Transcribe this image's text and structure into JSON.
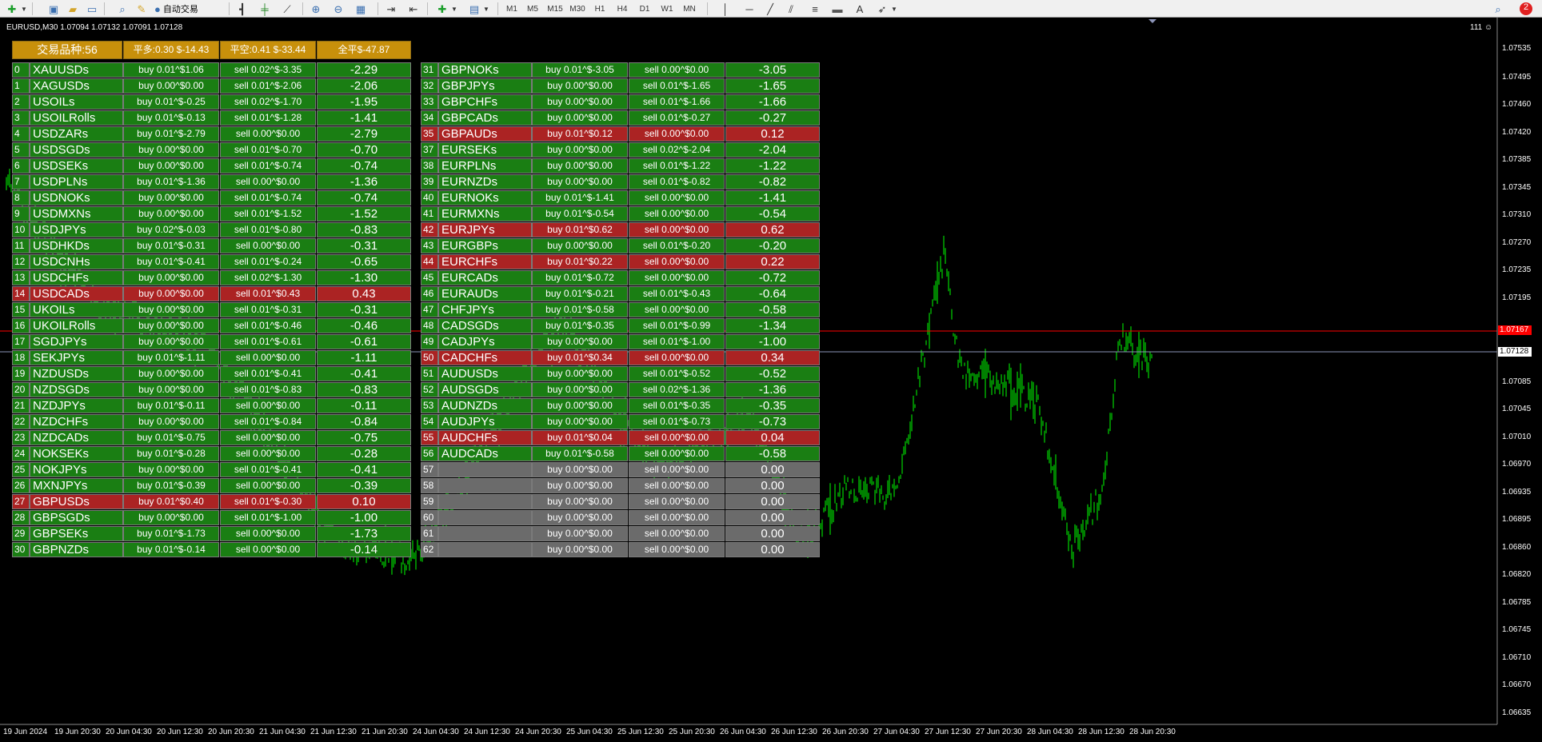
{
  "toolbar": {
    "auto_trading_label": "自动交易",
    "timeframes": [
      "M1",
      "M5",
      "M15",
      "M30",
      "H1",
      "H4",
      "D1",
      "W1",
      "MN"
    ],
    "notification_count": "2"
  },
  "chart": {
    "title": "EURUSD,M30  1.07094 1.07132 1.07091 1.07128",
    "counter": "111",
    "price_axis": [
      "1.07535",
      "1.07495",
      "1.07460",
      "1.07420",
      "1.07385",
      "1.07345",
      "1.07310",
      "1.07270",
      "1.07235",
      "1.07195",
      "1.07120",
      "1.07085",
      "1.07045",
      "1.07010",
      "1.06970",
      "1.06935",
      "1.06895",
      "1.06860",
      "1.06820",
      "1.06785",
      "1.06745",
      "1.06710",
      "1.06670",
      "1.06635"
    ],
    "ask_label": "1.07167",
    "bid_label": "1.07128",
    "time_axis": [
      "19 Jun 2024",
      "19 Jun 20:30",
      "20 Jun 04:30",
      "20 Jun 12:30",
      "20 Jun 20:30",
      "21 Jun 04:30",
      "21 Jun 12:30",
      "21 Jun 20:30",
      "24 Jun 04:30",
      "24 Jun 12:30",
      "24 Jun 20:30",
      "25 Jun 04:30",
      "25 Jun 12:30",
      "25 Jun 20:30",
      "26 Jun 04:30",
      "26 Jun 12:30",
      "26 Jun 20:30",
      "27 Jun 04:30",
      "27 Jun 12:30",
      "27 Jun 20:30",
      "28 Jun 04:30",
      "28 Jun 12:30",
      "28 Jun 20:30"
    ],
    "colors": {
      "bars": "#00ff00",
      "ask_line": "#ff0000",
      "bid_line": "#8c94b8",
      "background": "#000000"
    }
  },
  "panel": {
    "header": {
      "symbols": "交易品种:56",
      "close_buy": "平多:0.30 $-14.43",
      "close_sell": "平空:0.41 $-33.44",
      "close_all": "全平$-47.87"
    },
    "rows": [
      {
        "i": "0",
        "sym": "XAUUSDs",
        "buy": "buy 0.01^$1.06",
        "sell": "sell 0.02^$-3.35",
        "net": "-2.29",
        "st": "g"
      },
      {
        "i": "1",
        "sym": "XAGUSDs",
        "buy": "buy 0.00^$0.00",
        "sell": "sell 0.01^$-2.06",
        "net": "-2.06",
        "st": "g"
      },
      {
        "i": "2",
        "sym": "USOILs",
        "buy": "buy 0.01^$-0.25",
        "sell": "sell 0.02^$-1.70",
        "net": "-1.95",
        "st": "g"
      },
      {
        "i": "3",
        "sym": "USOILRolls",
        "buy": "buy 0.01^$-0.13",
        "sell": "sell 0.01^$-1.28",
        "net": "-1.41",
        "st": "g"
      },
      {
        "i": "4",
        "sym": "USDZARs",
        "buy": "buy 0.01^$-2.79",
        "sell": "sell 0.00^$0.00",
        "net": "-2.79",
        "st": "g"
      },
      {
        "i": "5",
        "sym": "USDSGDs",
        "buy": "buy 0.00^$0.00",
        "sell": "sell 0.01^$-0.70",
        "net": "-0.70",
        "st": "g"
      },
      {
        "i": "6",
        "sym": "USDSEKs",
        "buy": "buy 0.00^$0.00",
        "sell": "sell 0.01^$-0.74",
        "net": "-0.74",
        "st": "g"
      },
      {
        "i": "7",
        "sym": "USDPLNs",
        "buy": "buy 0.01^$-1.36",
        "sell": "sell 0.00^$0.00",
        "net": "-1.36",
        "st": "g"
      },
      {
        "i": "8",
        "sym": "USDNOKs",
        "buy": "buy 0.00^$0.00",
        "sell": "sell 0.01^$-0.74",
        "net": "-0.74",
        "st": "g"
      },
      {
        "i": "9",
        "sym": "USDMXNs",
        "buy": "buy 0.00^$0.00",
        "sell": "sell 0.01^$-1.52",
        "net": "-1.52",
        "st": "g"
      },
      {
        "i": "10",
        "sym": "USDJPYs",
        "buy": "buy 0.02^$-0.03",
        "sell": "sell 0.01^$-0.80",
        "net": "-0.83",
        "st": "g"
      },
      {
        "i": "11",
        "sym": "USDHKDs",
        "buy": "buy 0.01^$-0.31",
        "sell": "sell 0.00^$0.00",
        "net": "-0.31",
        "st": "g"
      },
      {
        "i": "12",
        "sym": "USDCNHs",
        "buy": "buy 0.01^$-0.41",
        "sell": "sell 0.01^$-0.24",
        "net": "-0.65",
        "st": "g"
      },
      {
        "i": "13",
        "sym": "USDCHFs",
        "buy": "buy 0.00^$0.00",
        "sell": "sell 0.02^$-1.30",
        "net": "-1.30",
        "st": "g"
      },
      {
        "i": "14",
        "sym": "USDCADs",
        "buy": "buy 0.00^$0.00",
        "sell": "sell 0.01^$0.43",
        "net": "0.43",
        "st": "r"
      },
      {
        "i": "15",
        "sym": "UKOILs",
        "buy": "buy 0.00^$0.00",
        "sell": "sell 0.01^$-0.31",
        "net": "-0.31",
        "st": "g"
      },
      {
        "i": "16",
        "sym": "UKOILRolls",
        "buy": "buy 0.00^$0.00",
        "sell": "sell 0.01^$-0.46",
        "net": "-0.46",
        "st": "g"
      },
      {
        "i": "17",
        "sym": "SGDJPYs",
        "buy": "buy 0.00^$0.00",
        "sell": "sell 0.01^$-0.61",
        "net": "-0.61",
        "st": "g"
      },
      {
        "i": "18",
        "sym": "SEKJPYs",
        "buy": "buy 0.01^$-1.11",
        "sell": "sell 0.00^$0.00",
        "net": "-1.11",
        "st": "g"
      },
      {
        "i": "19",
        "sym": "NZDUSDs",
        "buy": "buy 0.00^$0.00",
        "sell": "sell 0.01^$-0.41",
        "net": "-0.41",
        "st": "g"
      },
      {
        "i": "20",
        "sym": "NZDSGDs",
        "buy": "buy 0.00^$0.00",
        "sell": "sell 0.01^$-0.83",
        "net": "-0.83",
        "st": "g"
      },
      {
        "i": "21",
        "sym": "NZDJPYs",
        "buy": "buy 0.01^$-0.11",
        "sell": "sell 0.00^$0.00",
        "net": "-0.11",
        "st": "g"
      },
      {
        "i": "22",
        "sym": "NZDCHFs",
        "buy": "buy 0.00^$0.00",
        "sell": "sell 0.01^$-0.84",
        "net": "-0.84",
        "st": "g"
      },
      {
        "i": "23",
        "sym": "NZDCADs",
        "buy": "buy 0.01^$-0.75",
        "sell": "sell 0.00^$0.00",
        "net": "-0.75",
        "st": "g"
      },
      {
        "i": "24",
        "sym": "NOKSEKs",
        "buy": "buy 0.01^$-0.28",
        "sell": "sell 0.00^$0.00",
        "net": "-0.28",
        "st": "g"
      },
      {
        "i": "25",
        "sym": "NOKJPYs",
        "buy": "buy 0.00^$0.00",
        "sell": "sell 0.01^$-0.41",
        "net": "-0.41",
        "st": "g"
      },
      {
        "i": "26",
        "sym": "MXNJPYs",
        "buy": "buy 0.01^$-0.39",
        "sell": "sell 0.00^$0.00",
        "net": "-0.39",
        "st": "g"
      },
      {
        "i": "27",
        "sym": "GBPUSDs",
        "buy": "buy 0.01^$0.40",
        "sell": "sell 0.01^$-0.30",
        "net": "0.10",
        "st": "r"
      },
      {
        "i": "28",
        "sym": "GBPSGDs",
        "buy": "buy 0.00^$0.00",
        "sell": "sell 0.01^$-1.00",
        "net": "-1.00",
        "st": "g"
      },
      {
        "i": "29",
        "sym": "GBPSEKs",
        "buy": "buy 0.01^$-1.73",
        "sell": "sell 0.00^$0.00",
        "net": "-1.73",
        "st": "g"
      },
      {
        "i": "30",
        "sym": "GBPNZDs",
        "buy": "buy 0.01^$-0.14",
        "sell": "sell 0.00^$0.00",
        "net": "-0.14",
        "st": "g"
      },
      {
        "i": "31",
        "sym": "GBPNOKs",
        "buy": "buy 0.01^$-3.05",
        "sell": "sell 0.00^$0.00",
        "net": "-3.05",
        "st": "g"
      },
      {
        "i": "32",
        "sym": "GBPJPYs",
        "buy": "buy 0.00^$0.00",
        "sell": "sell 0.01^$-1.65",
        "net": "-1.65",
        "st": "g"
      },
      {
        "i": "33",
        "sym": "GBPCHFs",
        "buy": "buy 0.00^$0.00",
        "sell": "sell 0.01^$-1.66",
        "net": "-1.66",
        "st": "g"
      },
      {
        "i": "34",
        "sym": "GBPCADs",
        "buy": "buy 0.00^$0.00",
        "sell": "sell 0.01^$-0.27",
        "net": "-0.27",
        "st": "g"
      },
      {
        "i": "35",
        "sym": "GBPAUDs",
        "buy": "buy 0.01^$0.12",
        "sell": "sell 0.00^$0.00",
        "net": "0.12",
        "st": "r"
      },
      {
        "i": "37",
        "sym": "EURSEKs",
        "buy": "buy 0.00^$0.00",
        "sell": "sell 0.02^$-2.04",
        "net": "-2.04",
        "st": "g"
      },
      {
        "i": "38",
        "sym": "EURPLNs",
        "buy": "buy 0.00^$0.00",
        "sell": "sell 0.01^$-1.22",
        "net": "-1.22",
        "st": "g"
      },
      {
        "i": "39",
        "sym": "EURNZDs",
        "buy": "buy 0.00^$0.00",
        "sell": "sell 0.01^$-0.82",
        "net": "-0.82",
        "st": "g"
      },
      {
        "i": "40",
        "sym": "EURNOKs",
        "buy": "buy 0.01^$-1.41",
        "sell": "sell 0.00^$0.00",
        "net": "-1.41",
        "st": "g"
      },
      {
        "i": "41",
        "sym": "EURMXNs",
        "buy": "buy 0.01^$-0.54",
        "sell": "sell 0.00^$0.00",
        "net": "-0.54",
        "st": "g"
      },
      {
        "i": "42",
        "sym": "EURJPYs",
        "buy": "buy 0.01^$0.62",
        "sell": "sell 0.00^$0.00",
        "net": "0.62",
        "st": "r"
      },
      {
        "i": "43",
        "sym": "EURGBPs",
        "buy": "buy 0.00^$0.00",
        "sell": "sell 0.01^$-0.20",
        "net": "-0.20",
        "st": "g"
      },
      {
        "i": "44",
        "sym": "EURCHFs",
        "buy": "buy 0.01^$0.22",
        "sell": "sell 0.00^$0.00",
        "net": "0.22",
        "st": "r"
      },
      {
        "i": "45",
        "sym": "EURCADs",
        "buy": "buy 0.01^$-0.72",
        "sell": "sell 0.00^$0.00",
        "net": "-0.72",
        "st": "g"
      },
      {
        "i": "46",
        "sym": "EURAUDs",
        "buy": "buy 0.01^$-0.21",
        "sell": "sell 0.01^$-0.43",
        "net": "-0.64",
        "st": "g"
      },
      {
        "i": "47",
        "sym": "CHFJPYs",
        "buy": "buy 0.01^$-0.58",
        "sell": "sell 0.00^$0.00",
        "net": "-0.58",
        "st": "g"
      },
      {
        "i": "48",
        "sym": "CADSGDs",
        "buy": "buy 0.01^$-0.35",
        "sell": "sell 0.01^$-0.99",
        "net": "-1.34",
        "st": "g"
      },
      {
        "i": "49",
        "sym": "CADJPYs",
        "buy": "buy 0.00^$0.00",
        "sell": "sell 0.01^$-1.00",
        "net": "-1.00",
        "st": "g"
      },
      {
        "i": "50",
        "sym": "CADCHFs",
        "buy": "buy 0.01^$0.34",
        "sell": "sell 0.00^$0.00",
        "net": "0.34",
        "st": "r"
      },
      {
        "i": "51",
        "sym": "AUDUSDs",
        "buy": "buy 0.00^$0.00",
        "sell": "sell 0.01^$-0.52",
        "net": "-0.52",
        "st": "g"
      },
      {
        "i": "52",
        "sym": "AUDSGDs",
        "buy": "buy 0.00^$0.00",
        "sell": "sell 0.02^$-1.36",
        "net": "-1.36",
        "st": "g"
      },
      {
        "i": "53",
        "sym": "AUDNZDs",
        "buy": "buy 0.00^$0.00",
        "sell": "sell 0.01^$-0.35",
        "net": "-0.35",
        "st": "g"
      },
      {
        "i": "54",
        "sym": "AUDJPYs",
        "buy": "buy 0.00^$0.00",
        "sell": "sell 0.01^$-0.73",
        "net": "-0.73",
        "st": "g"
      },
      {
        "i": "55",
        "sym": "AUDCHFs",
        "buy": "buy 0.01^$0.04",
        "sell": "sell 0.00^$0.00",
        "net": "0.04",
        "st": "r"
      },
      {
        "i": "56",
        "sym": "AUDCADs",
        "buy": "buy 0.01^$-0.58",
        "sell": "sell 0.00^$0.00",
        "net": "-0.58",
        "st": "g"
      },
      {
        "i": "57",
        "sym": "",
        "buy": "buy 0.00^$0.00",
        "sell": "sell 0.00^$0.00",
        "net": "0.00",
        "st": "x"
      },
      {
        "i": "58",
        "sym": "",
        "buy": "buy 0.00^$0.00",
        "sell": "sell 0.00^$0.00",
        "net": "0.00",
        "st": "x"
      },
      {
        "i": "59",
        "sym": "",
        "buy": "buy 0.00^$0.00",
        "sell": "sell 0.00^$0.00",
        "net": "0.00",
        "st": "x"
      },
      {
        "i": "60",
        "sym": "",
        "buy": "buy 0.00^$0.00",
        "sell": "sell 0.00^$0.00",
        "net": "0.00",
        "st": "x"
      },
      {
        "i": "61",
        "sym": "",
        "buy": "buy 0.00^$0.00",
        "sell": "sell 0.00^$0.00",
        "net": "0.00",
        "st": "x"
      },
      {
        "i": "62",
        "sym": "",
        "buy": "buy 0.00^$0.00",
        "sell": "sell 0.00^$0.00",
        "net": "0.00",
        "st": "x"
      }
    ]
  }
}
